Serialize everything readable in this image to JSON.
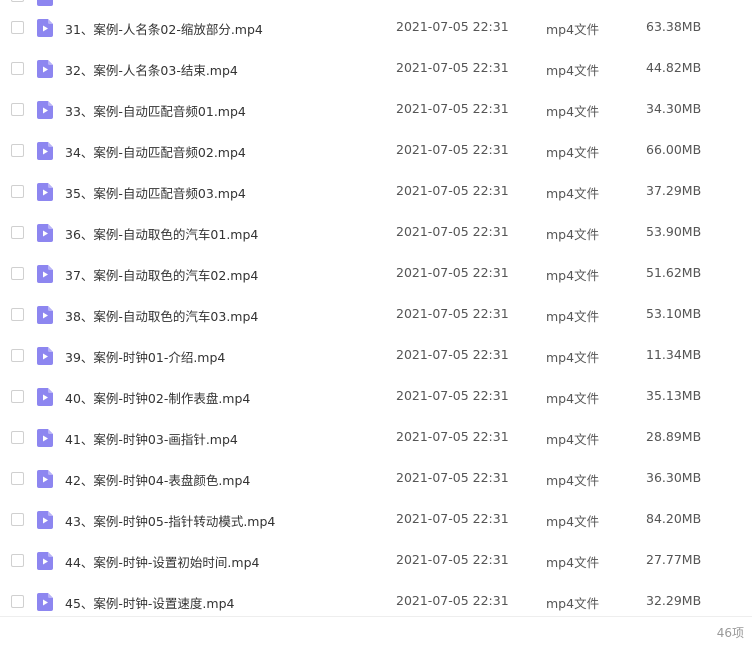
{
  "files": [
    {
      "name": "31、案例-人名条02-缩放部分.mp4",
      "date": "2021-07-05 22:31",
      "type": "mp4文件",
      "size": "63.38MB"
    },
    {
      "name": "32、案例-人名条03-结束.mp4",
      "date": "2021-07-05 22:31",
      "type": "mp4文件",
      "size": "44.82MB"
    },
    {
      "name": "33、案例-自动匹配音频01.mp4",
      "date": "2021-07-05 22:31",
      "type": "mp4文件",
      "size": "34.30MB"
    },
    {
      "name": "34、案例-自动匹配音频02.mp4",
      "date": "2021-07-05 22:31",
      "type": "mp4文件",
      "size": "66.00MB"
    },
    {
      "name": "35、案例-自动匹配音频03.mp4",
      "date": "2021-07-05 22:31",
      "type": "mp4文件",
      "size": "37.29MB"
    },
    {
      "name": "36、案例-自动取色的汽车01.mp4",
      "date": "2021-07-05 22:31",
      "type": "mp4文件",
      "size": "53.90MB"
    },
    {
      "name": "37、案例-自动取色的汽车02.mp4",
      "date": "2021-07-05 22:31",
      "type": "mp4文件",
      "size": "51.62MB"
    },
    {
      "name": "38、案例-自动取色的汽车03.mp4",
      "date": "2021-07-05 22:31",
      "type": "mp4文件",
      "size": "53.10MB"
    },
    {
      "name": "39、案例-时钟01-介绍.mp4",
      "date": "2021-07-05 22:31",
      "type": "mp4文件",
      "size": "11.34MB"
    },
    {
      "name": "40、案例-时钟02-制作表盘.mp4",
      "date": "2021-07-05 22:31",
      "type": "mp4文件",
      "size": "35.13MB"
    },
    {
      "name": "41、案例-时钟03-画指针.mp4",
      "date": "2021-07-05 22:31",
      "type": "mp4文件",
      "size": "28.89MB"
    },
    {
      "name": "42、案例-时钟04-表盘颜色.mp4",
      "date": "2021-07-05 22:31",
      "type": "mp4文件",
      "size": "36.30MB"
    },
    {
      "name": "43、案例-时钟05-指针转动模式.mp4",
      "date": "2021-07-05 22:31",
      "type": "mp4文件",
      "size": "84.20MB"
    },
    {
      "name": "44、案例-时钟-设置初始时间.mp4",
      "date": "2021-07-05 22:31",
      "type": "mp4文件",
      "size": "27.77MB"
    },
    {
      "name": "45、案例-时钟-设置速度.mp4",
      "date": "2021-07-05 22:31",
      "type": "mp4文件",
      "size": "32.29MB"
    }
  ],
  "footer": {
    "count": "46项"
  },
  "colors": {
    "video_icon": "#8d86f0",
    "video_icon_fold": "#b9b4f7"
  },
  "icons": {
    "file": "video-file-icon"
  }
}
